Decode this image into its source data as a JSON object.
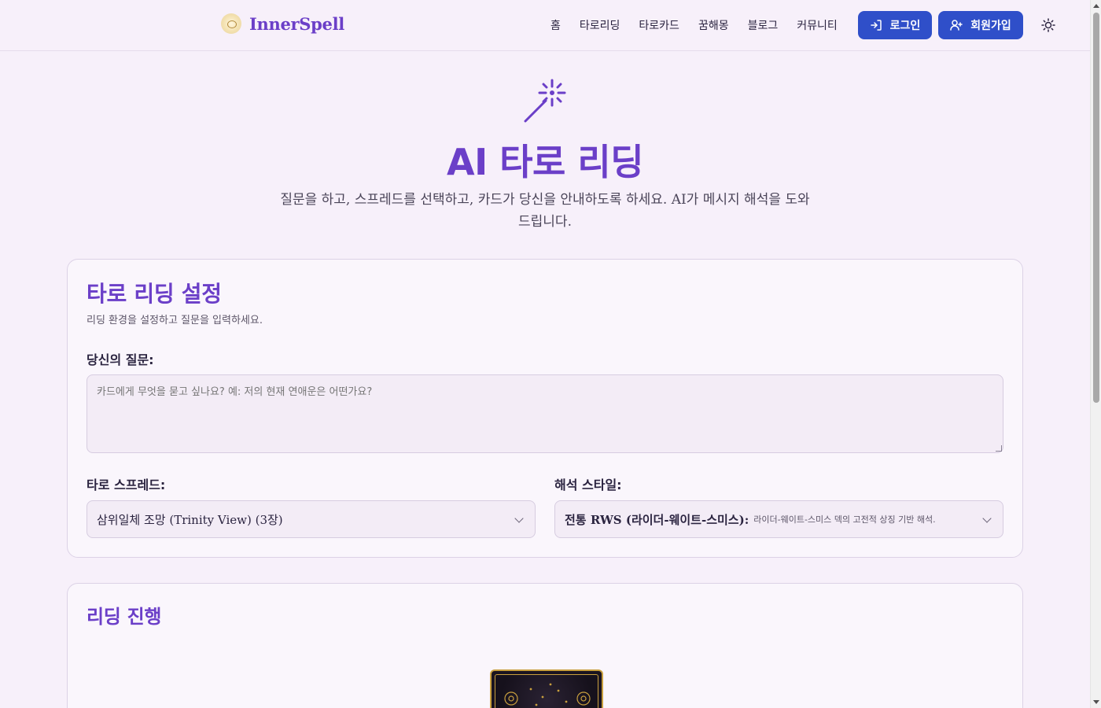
{
  "header": {
    "logo_text": "InnerSpell",
    "nav": [
      "홈",
      "타로리딩",
      "타로카드",
      "꿈해몽",
      "블로그",
      "커뮤니티"
    ],
    "login_label": "로그인",
    "signup_label": "회원가입"
  },
  "hero": {
    "title": "AI 타로 리딩",
    "subtitle": "질문을 하고, 스프레드를 선택하고, 카드가 당신을 안내하도록 하세요. AI가 메시지 해석을 도와드립니다."
  },
  "settings": {
    "title": "타로 리딩 설정",
    "description": "리딩 환경을 설정하고 질문을 입력하세요.",
    "question_label": "당신의 질문:",
    "question_placeholder": "카드에게 무엇을 묻고 싶나요? 예: 저의 현재 연애운은 어떤가요?",
    "spread_label": "타로 스프레드:",
    "spread_value": "삼위일체 조망 (Trinity View) (3장)",
    "style_label": "해석 스타일:",
    "style_value": "전통 RWS (라이더-웨이트-스미스):",
    "style_hint": "라이더-웨이트-스미스 덱의 고전적 상징 기반 해석."
  },
  "progress": {
    "title": "리딩 진행"
  },
  "colors": {
    "accent": "#6b3fc8",
    "button": "#2f4fc9",
    "background": "#f7f0fa"
  },
  "icons": {
    "logo": "eye-logo-icon",
    "login": "login-arrow-icon",
    "signup": "user-plus-icon",
    "theme": "sun-icon",
    "hero": "magic-wand-icon"
  }
}
